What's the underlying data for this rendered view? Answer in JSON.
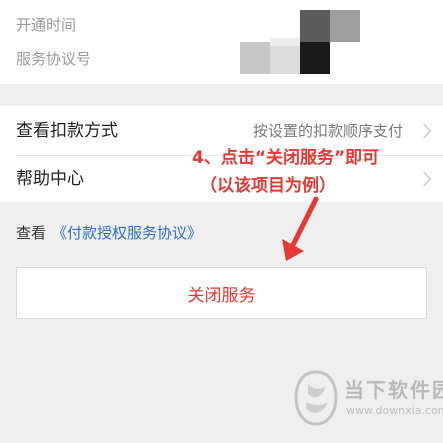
{
  "info": {
    "open_time_label": "开通时间",
    "agreement_no_label": "服务协议号"
  },
  "list": {
    "payment_method": {
      "label": "查看扣款方式",
      "value": "按设置的扣款顺序支付"
    },
    "help_center": {
      "label": "帮助中心"
    }
  },
  "annotation": {
    "line1": "4、点击“关闭服务”即可",
    "line2": "（以该项目为例）",
    "color": "#e53935"
  },
  "agreement": {
    "prefix": "查看",
    "link": "《付款授权服务协议》"
  },
  "close_button": {
    "label": "关闭服务"
  },
  "watermark": {
    "title": "当下软件园",
    "url": "www.downxia.com"
  },
  "colors": {
    "accent_red": "#e53935",
    "link_blue": "#2f6fc6",
    "background": "#efefef"
  }
}
